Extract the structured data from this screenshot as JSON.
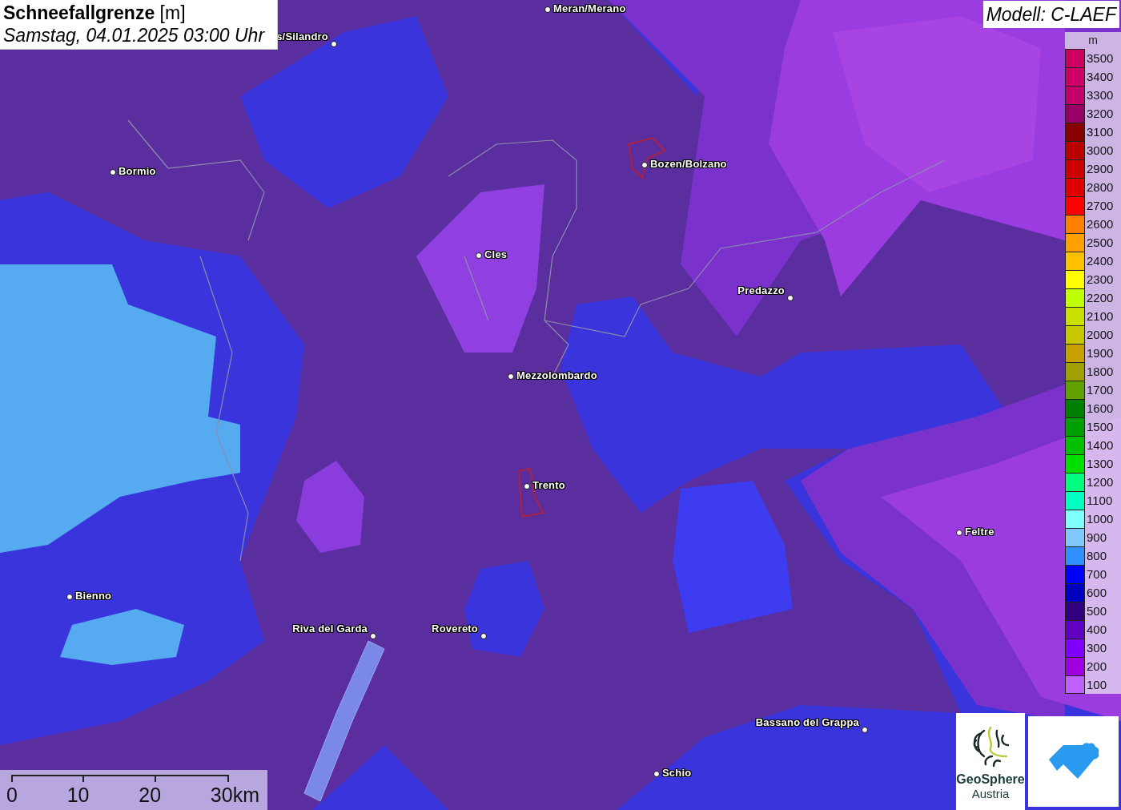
{
  "title": {
    "heading": "**Schneefallgrenze** [m]",
    "datetime": "Samstag, 04.01.2025 03:00 Uhr"
  },
  "model": "Modell: C-LAEF",
  "cities": [
    "Meran/Merano",
    "s/Silandro",
    "Bormio",
    "Bozen/Bolzano",
    "Cles",
    "Predazzo",
    "Mezzolombardo",
    "Trento",
    "Feltre",
    "Bienno",
    "Riva del Garda",
    "Rovereto",
    "Bassano del Grappa",
    "Schio"
  ],
  "legend": {
    "unit": "m",
    "items": [
      {
        "label": "3500",
        "color": "#cc0060"
      },
      {
        "label": "3400",
        "color": "#cc0066"
      },
      {
        "label": "3300",
        "color": "#c2006a"
      },
      {
        "label": "3200",
        "color": "#990066"
      },
      {
        "label": "3100",
        "color": "#880000"
      },
      {
        "label": "3000",
        "color": "#bb0000"
      },
      {
        "label": "2900",
        "color": "#cc0000"
      },
      {
        "label": "2800",
        "color": "#e00000"
      },
      {
        "label": "2700",
        "color": "#ff0000"
      },
      {
        "label": "2600",
        "color": "#ff8000"
      },
      {
        "label": "2500",
        "color": "#ffa000"
      },
      {
        "label": "2400",
        "color": "#ffc000"
      },
      {
        "label": "2300",
        "color": "#ffff00"
      },
      {
        "label": "2200",
        "color": "#c0ff00"
      },
      {
        "label": "2100",
        "color": "#c8e000"
      },
      {
        "label": "2000",
        "color": "#c8c800"
      },
      {
        "label": "1900",
        "color": "#c8a000"
      },
      {
        "label": "1800",
        "color": "#a0a000"
      },
      {
        "label": "1700",
        "color": "#60a000"
      },
      {
        "label": "1600",
        "color": "#008000"
      },
      {
        "label": "1500",
        "color": "#00a000"
      },
      {
        "label": "1400",
        "color": "#00c000"
      },
      {
        "label": "1300",
        "color": "#00e000"
      },
      {
        "label": "1200",
        "color": "#00ff80"
      },
      {
        "label": "1100",
        "color": "#00ffc0"
      },
      {
        "label": "1000",
        "color": "#80ffff"
      },
      {
        "label": "900",
        "color": "#80c8ff"
      },
      {
        "label": "800",
        "color": "#3090ff"
      },
      {
        "label": "700",
        "color": "#0000ff"
      },
      {
        "label": "600",
        "color": "#0000c0"
      },
      {
        "label": "500",
        "color": "#300080"
      },
      {
        "label": "400",
        "color": "#6000c0"
      },
      {
        "label": "300",
        "color": "#8000ff"
      },
      {
        "label": "200",
        "color": "#a000e0"
      },
      {
        "label": "100",
        "color": "#c060ff"
      }
    ]
  },
  "scale_bar": {
    "labels": [
      "0",
      "10",
      "20",
      "30km"
    ]
  },
  "logo": {
    "line1": "GeoSphere",
    "line2": "Austria"
  }
}
